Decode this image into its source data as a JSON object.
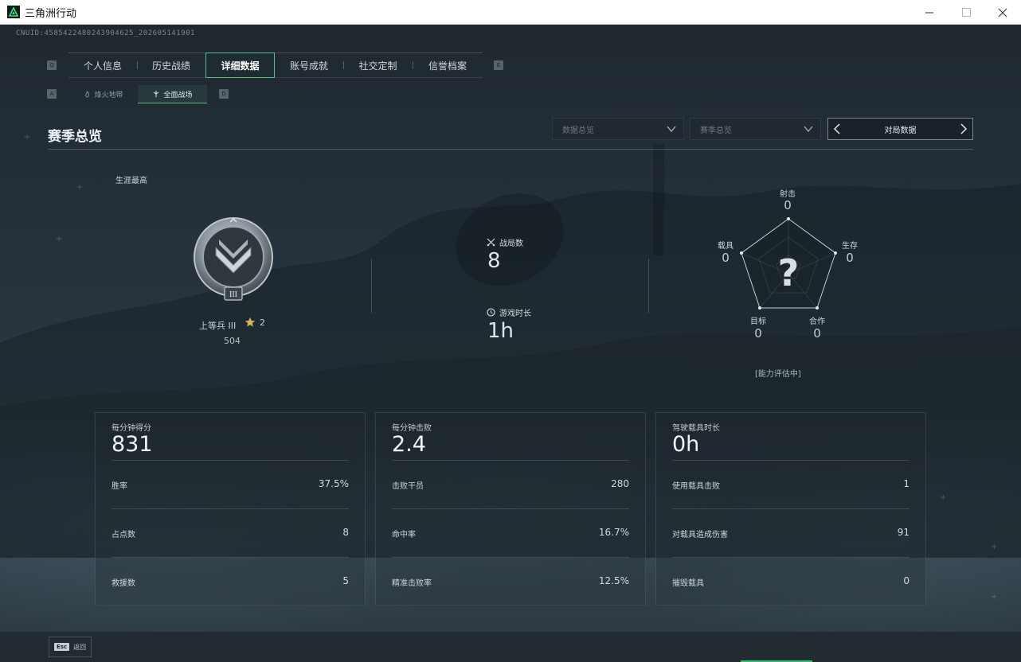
{
  "window": {
    "title": "三角洲行动",
    "minimize": "—",
    "maximize": "☐",
    "close": "✕"
  },
  "uid": "CNUID:4585422480243904625_202605141901",
  "main_tabs": [
    {
      "label": "个人信息",
      "active": false
    },
    {
      "label": "历史战绩",
      "active": false
    },
    {
      "label": "详细数据",
      "active": true
    },
    {
      "label": "账号成就",
      "active": false
    },
    {
      "label": "社交定制",
      "active": false
    },
    {
      "label": "信誉档案",
      "active": false
    }
  ],
  "key_hints": {
    "left_main": "Q",
    "right_main": "E",
    "left_sub": "A",
    "right_sub": "D"
  },
  "sub_tabs": [
    {
      "label": "烽火地带",
      "icon": "flame-icon",
      "active": false
    },
    {
      "label": "全面战场",
      "icon": "crosshair-icon",
      "active": true
    }
  ],
  "section": {
    "title": "赛季总览",
    "select_data": "数据总览",
    "select_season": "赛季总览",
    "switcher_label": "对局数据"
  },
  "career": {
    "label": "生涯最高",
    "rank_name": "上等兵 III",
    "rank_badge_numeral": "III",
    "stars": "2",
    "score": "504"
  },
  "overview": {
    "matches_label": "战局数",
    "matches_value": "8",
    "playtime_label": "游戏时长",
    "playtime_value": "1h"
  },
  "radar": {
    "center_mark": "?",
    "status": "[能力评估中]",
    "axes": [
      {
        "key": "shoot",
        "label": "射击",
        "value": "0"
      },
      {
        "key": "survive",
        "label": "生存",
        "value": "0"
      },
      {
        "key": "coop",
        "label": "合作",
        "value": "0"
      },
      {
        "key": "target",
        "label": "目标",
        "value": "0"
      },
      {
        "key": "vehicle",
        "label": "载具",
        "value": "0"
      }
    ]
  },
  "cards": [
    {
      "title": "每分钟得分",
      "value": "831",
      "rows": [
        {
          "label": "胜率",
          "value": "37.5%"
        },
        {
          "label": "占点数",
          "value": "8"
        },
        {
          "label": "救援数",
          "value": "5"
        }
      ]
    },
    {
      "title": "每分钟击败",
      "value": "2.4",
      "rows": [
        {
          "label": "击败干员",
          "value": "280"
        },
        {
          "label": "命中率",
          "value": "16.7%"
        },
        {
          "label": "精准击败率",
          "value": "12.5%"
        }
      ]
    },
    {
      "title": "驾驶载具时长",
      "value": "0h",
      "rows": [
        {
          "label": "使用载具击败",
          "value": "1"
        },
        {
          "label": "对载具造成伤害",
          "value": "91"
        },
        {
          "label": "摧毁载具",
          "value": "0"
        }
      ]
    }
  ],
  "footer": {
    "esc_key": "Esc",
    "back_label": "返回"
  },
  "colors": {
    "accent": "#55c08a",
    "background": "#1b2329"
  }
}
